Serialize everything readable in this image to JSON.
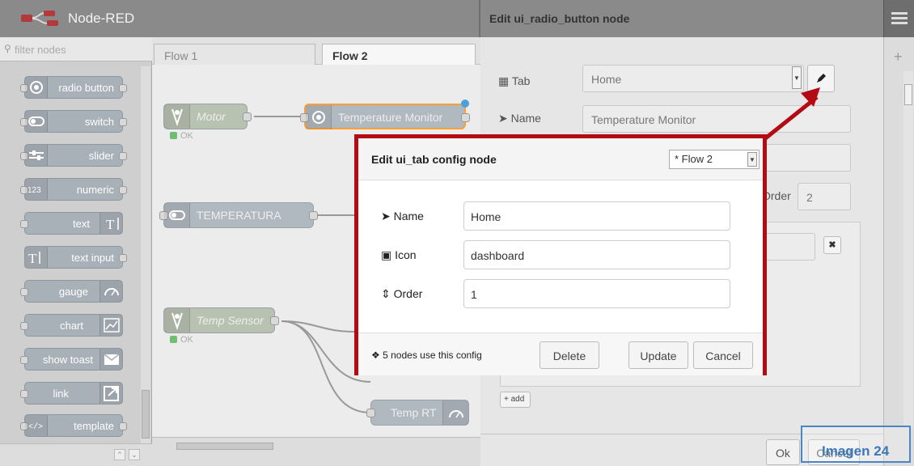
{
  "app": {
    "title": "Node-RED",
    "edit_title": "Edit ui_radio_button node"
  },
  "palette": {
    "filter_placeholder": "filter nodes",
    "nodes": [
      {
        "label": "radio button",
        "icon": "radio-icon"
      },
      {
        "label": "switch",
        "icon": "switch-icon"
      },
      {
        "label": "slider",
        "icon": "slider-icon"
      },
      {
        "label": "numeric",
        "icon": "numeric-icon"
      },
      {
        "label": "text",
        "icon": "text-icon"
      },
      {
        "label": "text input",
        "icon": "text-input-icon"
      },
      {
        "label": "gauge",
        "icon": "gauge-icon"
      },
      {
        "label": "chart",
        "icon": "chart-icon"
      },
      {
        "label": "show toast",
        "icon": "toast-icon"
      },
      {
        "label": "link",
        "icon": "link-icon"
      },
      {
        "label": "template",
        "icon": "template-icon"
      }
    ]
  },
  "workspace": {
    "tabs": [
      {
        "label": "Flow 1"
      },
      {
        "label": "Flow 2"
      }
    ],
    "nodes": [
      {
        "label": "Motor",
        "status": "OK"
      },
      {
        "label": "Temperature Monitor"
      },
      {
        "label": "TEMPERATURA"
      },
      {
        "label": "Temp Sensor",
        "status": "OK"
      },
      {
        "label": "Temp RT"
      }
    ]
  },
  "edit_panel": {
    "tab_label": "Tab",
    "tab_value": "Home",
    "name_label": "Name",
    "name_value": "Temperature Monitor",
    "order_label": "Order",
    "order_value": "2",
    "add_label": "add",
    "ok_label": "Ok",
    "cancel_label": "Cancel"
  },
  "dialog": {
    "title": "Edit ui_tab config node",
    "scope": "* Flow 2",
    "name_label": "Name",
    "name_value": "Home",
    "icon_label": "Icon",
    "icon_value": "dashboard",
    "order_label": "Order",
    "order_value": "1",
    "info": "5 nodes use this config",
    "delete_label": "Delete",
    "update_label": "Update",
    "cancel_label": "Cancel"
  },
  "caption": "Imagen  24",
  "colors": {
    "highlight_frame": "#b30b14",
    "caption": "#3c78b8",
    "status_ok": "#6fbf73"
  }
}
